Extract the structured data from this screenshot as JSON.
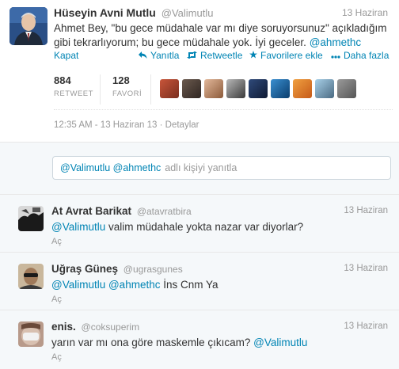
{
  "main_tweet": {
    "fullname": "Hüseyin Avni Mutlu",
    "username": "@Valimutlu",
    "date": "13 Haziran",
    "text_line1": "Ahmet Bey, \"bu gece müdahale var mı diye soruyorsunuz\" açıkladığım",
    "text_line2_plain": "gibi tekrarlıyorum; bu gece müdahale yok. İyi geceler.",
    "text_line2_mention": "@ahmethc",
    "actions": {
      "collapse": "Kapat",
      "reply": "Yanıtla",
      "retweet": "Retweetle",
      "favorite": "Favorilere ekle",
      "more": "Daha fazla"
    },
    "stats": {
      "retweet_count": "884",
      "retweet_label": "RETWEET",
      "favorite_count": "128",
      "favorite_label": "FAVORİ"
    },
    "timestamp": "12:35 AM - 13 Haziran 13",
    "detail_link": "Detaylar"
  },
  "reply_box": {
    "mentions": "@Valimutlu @ahmethc",
    "placeholder_rest": "adlı kişiyi yanıtla"
  },
  "replies": [
    {
      "fullname": "At Avrat Barikat",
      "username": "@atavratbira",
      "date": "13 Haziran",
      "mention": "@Valimutlu",
      "text": "valim müdahale yokta nazar var diyorlar?",
      "action": "Aç"
    },
    {
      "fullname": "Uğraş Güneş",
      "username": "@ugrasgunes",
      "date": "13 Haziran",
      "mention": "@Valimutlu @ahmethc",
      "text": "İns Cnm Ya",
      "action": "Aç"
    },
    {
      "fullname": "enis.",
      "username": "@coksuperim",
      "date": "13 Haziran",
      "text": "yarın var mı ona göre maskemle çıkıcam?",
      "mention": "@Valimutlu",
      "action": "Aç"
    }
  ],
  "colors": {
    "link": "#0084b4",
    "muted": "#999999",
    "reply_bg": "#f5f8fa"
  },
  "icons": {
    "reply": "reply-arrow-icon",
    "retweet": "retweet-icon",
    "favorite": "star-icon",
    "more": "more-dots-icon"
  }
}
